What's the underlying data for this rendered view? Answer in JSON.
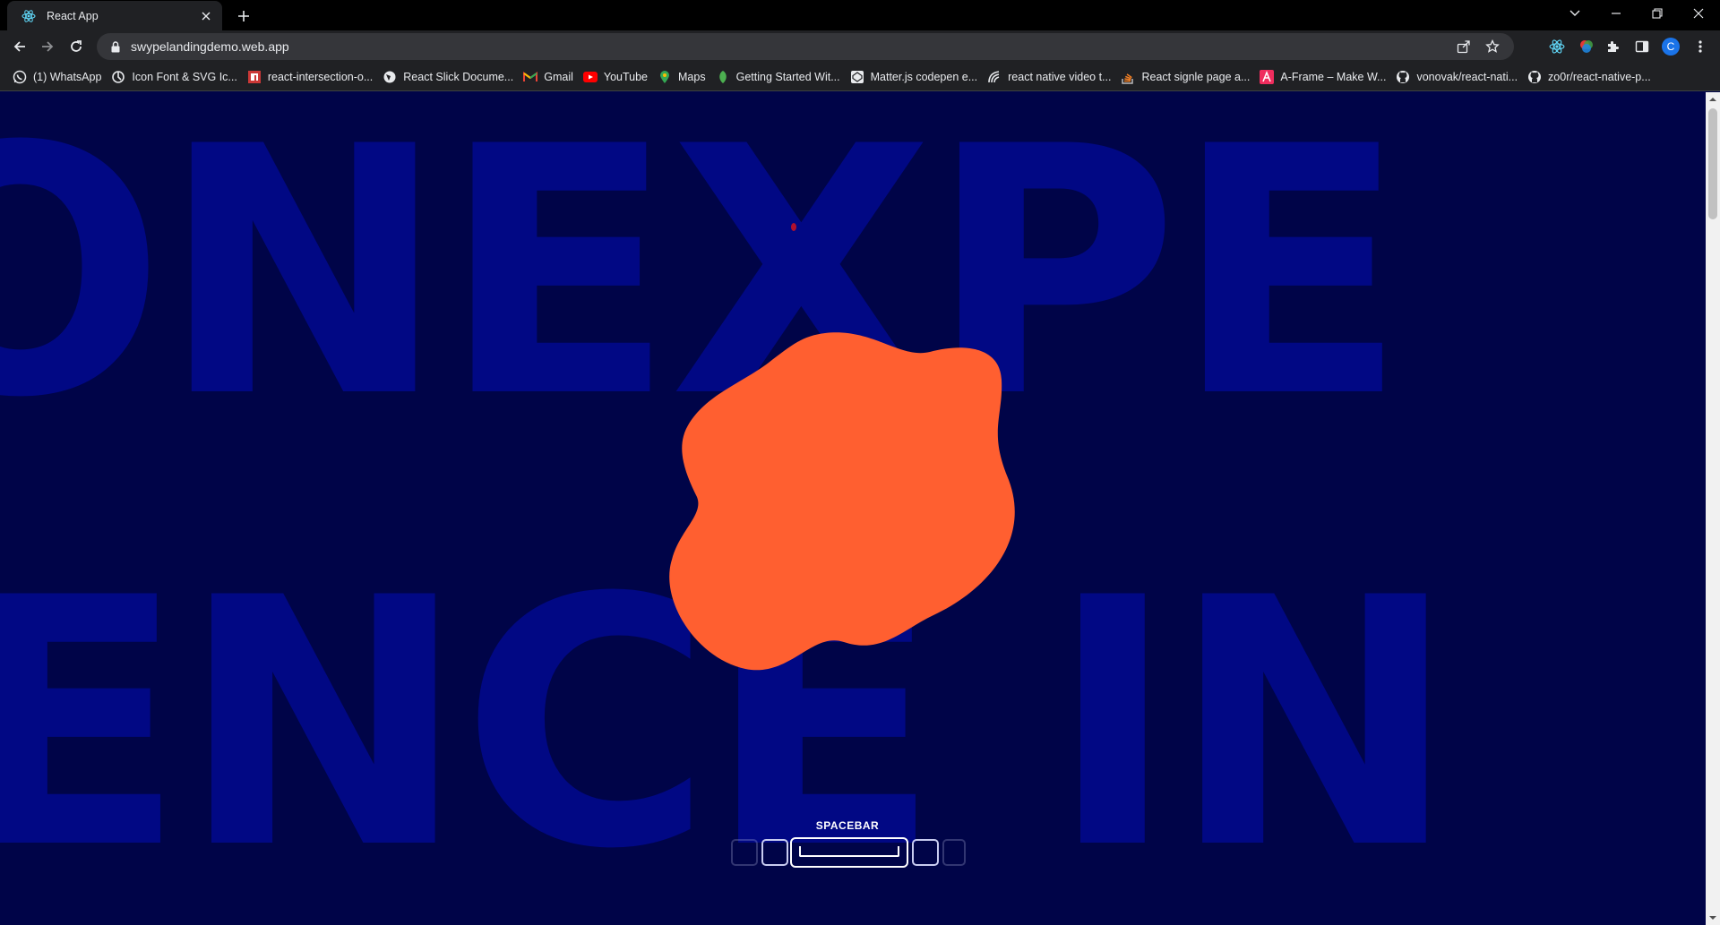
{
  "browser": {
    "tab": {
      "title": "React App",
      "icon": "react-icon"
    },
    "url": "swypelandingdemo.web.app",
    "profile_initial": "C",
    "bookmarks": [
      {
        "label": "(1) WhatsApp",
        "icon": "whatsapp-icon"
      },
      {
        "label": "Icon Font & SVG Ic...",
        "icon": "icomoon-icon"
      },
      {
        "label": "react-intersection-o...",
        "icon": "npm-icon"
      },
      {
        "label": "React Slick Docume...",
        "icon": "globe-icon"
      },
      {
        "label": "Gmail",
        "icon": "gmail-icon"
      },
      {
        "label": "YouTube",
        "icon": "youtube-icon"
      },
      {
        "label": "Maps",
        "icon": "maps-icon"
      },
      {
        "label": "Getting Started Wit...",
        "icon": "leaf-icon"
      },
      {
        "label": "Matter.js codepen e...",
        "icon": "codepen-icon"
      },
      {
        "label": "react native video t...",
        "icon": "react-native-icon"
      },
      {
        "label": "React signle page a...",
        "icon": "stackoverflow-icon"
      },
      {
        "label": "A-Frame – Make W...",
        "icon": "aframe-icon"
      },
      {
        "label": "vonovak/react-nati...",
        "icon": "github-icon"
      },
      {
        "label": "zo0r/react-native-p...",
        "icon": "github-icon"
      }
    ]
  },
  "page": {
    "background_line_1": "ONEXPE",
    "background_line_2": "ENCE IN",
    "spacebar_label": "SPACEBAR",
    "colors": {
      "background": "#000448",
      "big_text": "#010884",
      "blob": "#ff5f30",
      "key_outline": "#ffffff"
    }
  }
}
